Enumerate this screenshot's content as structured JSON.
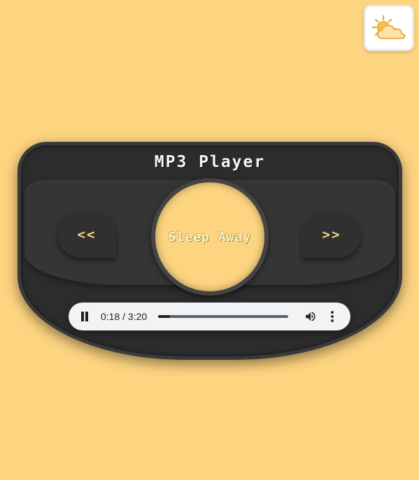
{
  "theme_toggle": {
    "icon": "sun-cloud-icon"
  },
  "player": {
    "title": "MP3 Player",
    "prev_label": "<<",
    "next_label": ">>",
    "song_title": "Sleep Away"
  },
  "audio": {
    "current_time": "0:18",
    "duration": "3:20",
    "time_display": "0:18 / 3:20",
    "progress": 0.09,
    "state": "playing",
    "icons": [
      "pause-icon",
      "volume-icon",
      "more-options-icon"
    ]
  },
  "colors": {
    "background": "#fdd480",
    "player_body": "#2c2c2c",
    "accent": "#fdd480",
    "controls_bg": "#f1f3f4"
  }
}
